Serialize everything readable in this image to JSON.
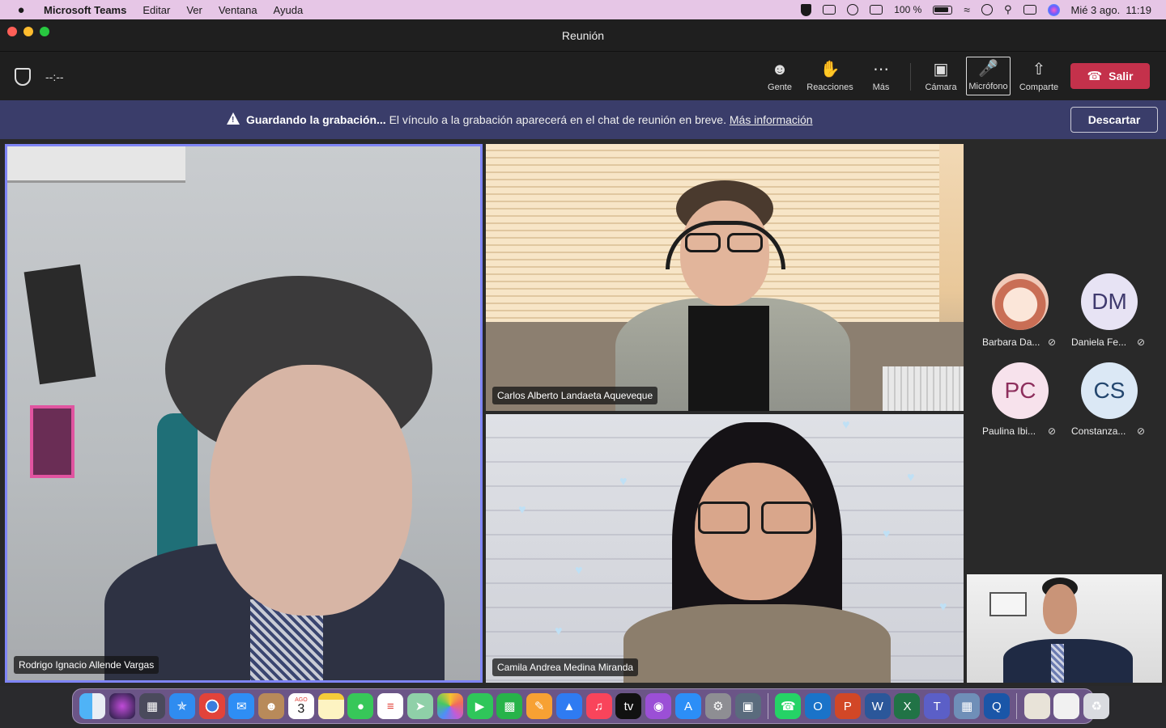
{
  "menubar": {
    "apple_glyph": "",
    "app_name": "Microsoft Teams",
    "menus": [
      "Editar",
      "Ver",
      "Ventana",
      "Ayuda"
    ],
    "battery_percent": "100 %",
    "clock": "Mié 3 ago.  11:19"
  },
  "window": {
    "title": "Reunión"
  },
  "toolbar": {
    "timer": "--:--",
    "people_label": "Gente",
    "reactions_label": "Reacciones",
    "more_label": "Más",
    "camera_label": "Cámara",
    "mic_label": "Micrófono",
    "share_label": "Comparte",
    "leave_label": "Salir"
  },
  "banner": {
    "bold_text": "Guardando la grabación...",
    "text": " El vínculo a la grabación aparecerá en el chat de reunión en breve. ",
    "link_text": "Más información",
    "dismiss_label": "Descartar"
  },
  "tiles": [
    {
      "name": "Rodrigo Ignacio Allende Vargas"
    },
    {
      "name": "Carlos Alberto Landaeta Aqueveque"
    },
    {
      "name": "Camila Andrea Medina Miranda"
    }
  ],
  "roster": [
    {
      "initials": "",
      "name": "Barbara Da...",
      "avatar_bg": "#f4d3c9",
      "avatar_fg": "#a34a3a"
    },
    {
      "initials": "DM",
      "name": "Daniela Fe...",
      "avatar_bg": "#e7e3f4",
      "avatar_fg": "#3f3a6e"
    },
    {
      "initials": "PC",
      "name": "Paulina Ibi...",
      "avatar_bg": "#f7e2ec",
      "avatar_fg": "#8d2e5c"
    },
    {
      "initials": "CS",
      "name": "Constanza...",
      "avatar_bg": "#dbe8f5",
      "avatar_fg": "#23466e"
    }
  ],
  "dock": {
    "calendar_month": "AGO",
    "calendar_day": "3"
  },
  "colors": {
    "accent": "#7f85f5",
    "leave": "#c4314b",
    "banner": "#3a3d6a"
  }
}
